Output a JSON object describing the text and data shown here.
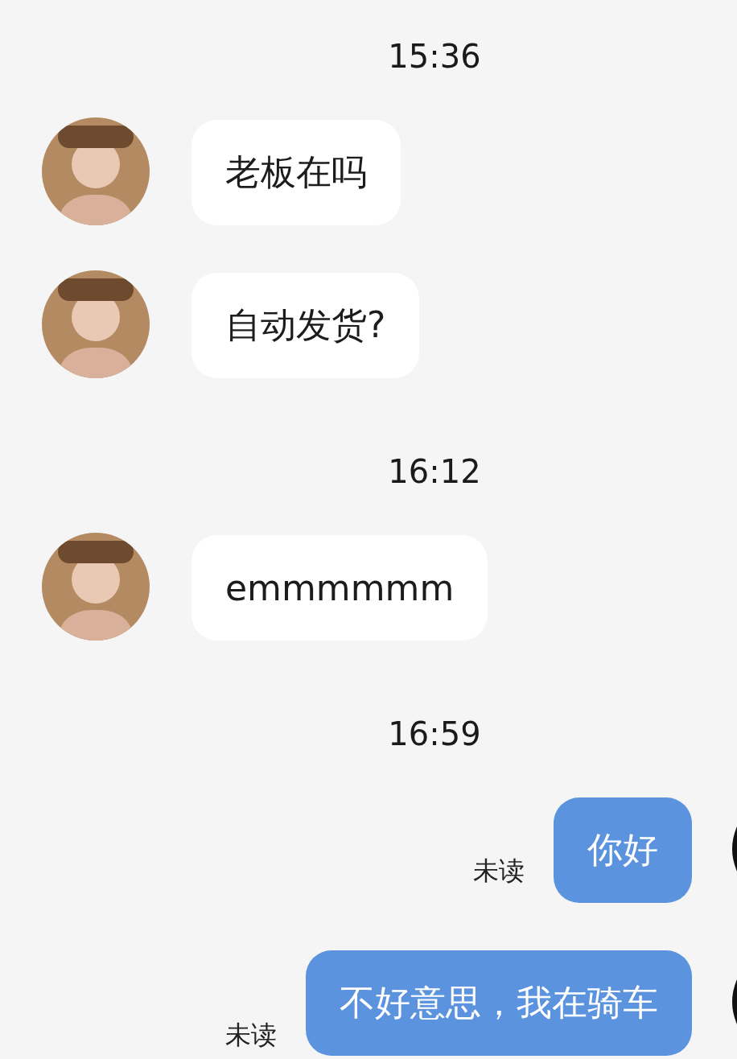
{
  "messages": [
    {
      "kind": "time",
      "text": "15:36"
    },
    {
      "kind": "incoming",
      "text": "老板在吗"
    },
    {
      "kind": "incoming",
      "text": "自动发货?"
    },
    {
      "kind": "time",
      "text": "16:12"
    },
    {
      "kind": "incoming",
      "text": "emmmmmm"
    },
    {
      "kind": "time",
      "text": "16:59"
    },
    {
      "kind": "outgoing",
      "text": "你好",
      "status": "未读"
    },
    {
      "kind": "outgoing",
      "text": "不好意思，我在骑车",
      "status": "未读"
    }
  ]
}
